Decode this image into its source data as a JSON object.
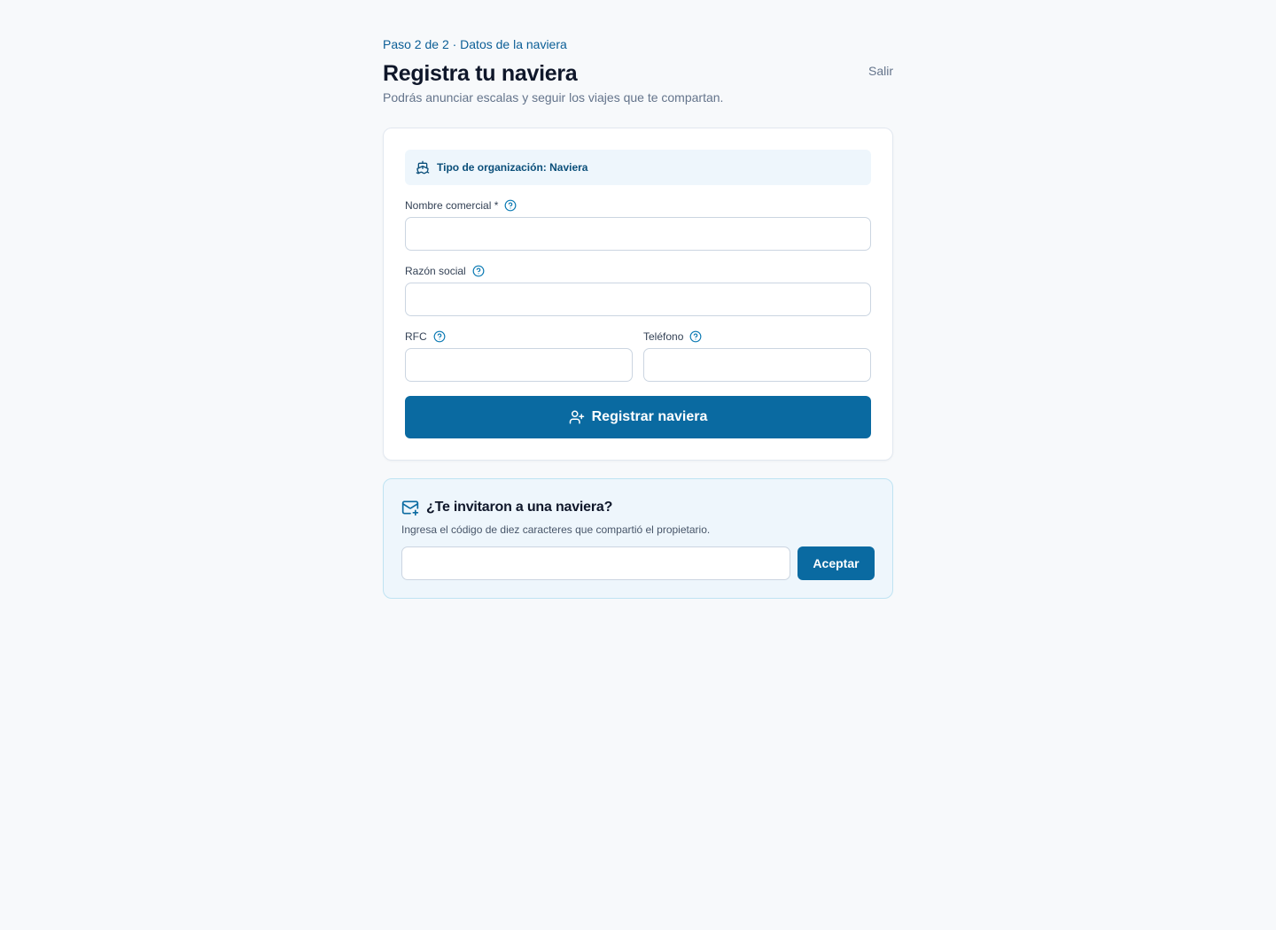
{
  "header": {
    "step": "Paso 2 de 2 · Datos de la naviera",
    "title": "Registra tu naviera",
    "subtitle": "Podrás anunciar escalas y seguir los viajes que te compartan.",
    "exit_label": "Salir"
  },
  "form": {
    "org_type_banner": "Tipo de organización: Naviera",
    "fields": {
      "nombre_comercial": {
        "label": "Nombre comercial *",
        "value": "",
        "placeholder": ""
      },
      "razon_social": {
        "label": "Razón social",
        "value": "",
        "placeholder": ""
      },
      "rfc": {
        "label": "RFC",
        "value": "",
        "placeholder": ""
      },
      "telefono": {
        "label": "Teléfono",
        "value": "",
        "placeholder": ""
      }
    },
    "submit_label": "Registrar naviera"
  },
  "invite": {
    "title": "¿Te invitaron a una naviera?",
    "description": "Ingresa el código de diez caracteres que compartió el propietario.",
    "code_value": "",
    "accept_label": "Aceptar"
  },
  "colors": {
    "accent": "#0a6aa1",
    "step_text": "#0b5e96",
    "background": "#f7f9fb",
    "banner_bg": "#eef6fc"
  },
  "icons": {
    "org_banner": "ship-icon",
    "field_help": "help-circle-icon",
    "submit": "user-plus-icon",
    "invite": "mail-plus-icon"
  }
}
